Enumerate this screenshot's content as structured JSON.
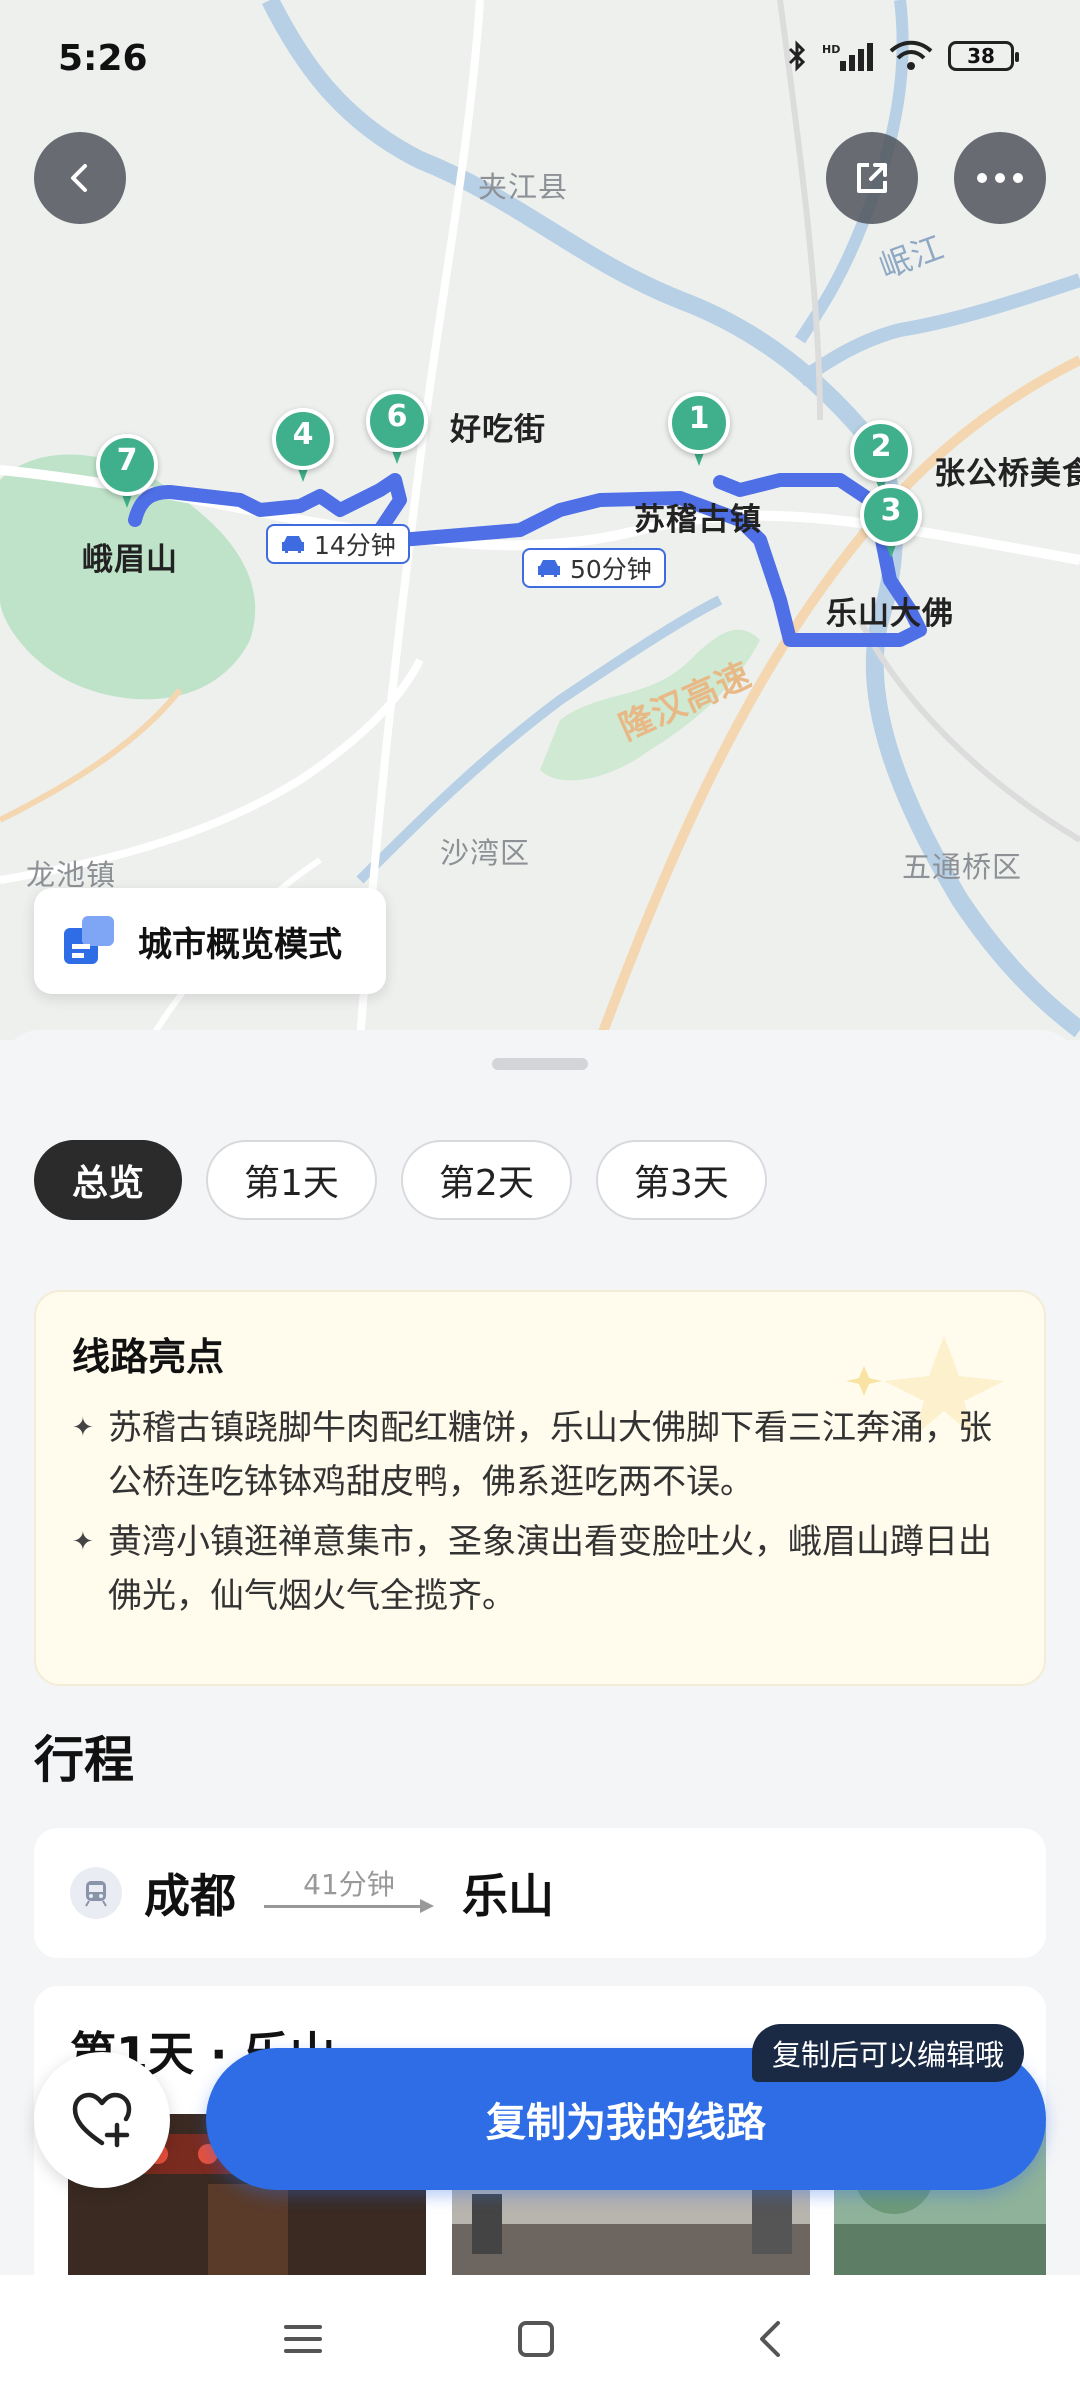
{
  "status_bar": {
    "time": "5:26",
    "battery": "38"
  },
  "map": {
    "labels": {
      "jiajiang": "夹江县",
      "minjiang": "岷江",
      "haochijie": "好吃街",
      "zhanggongqiao": "张公桥美食",
      "sujigu": "苏稽古镇",
      "leshan_dafo": "乐山大佛",
      "emeishan": "峨眉山",
      "longhan": "隆汉高速",
      "shawan": "沙湾区",
      "longchi": "龙池镇",
      "wutongqiao": "五通桥区"
    },
    "pins": [
      "1",
      "2",
      "3",
      "4",
      "6",
      "7"
    ],
    "durations": {
      "d1": "14分钟",
      "d2": "50分钟"
    },
    "overview_mode": "城市概览模式",
    "colors": {
      "route": "#4e6fe6",
      "pin": "#3fb08b"
    }
  },
  "tabs": [
    {
      "label": "总览",
      "active": true
    },
    {
      "label": "第1天",
      "active": false
    },
    {
      "label": "第2天",
      "active": false
    },
    {
      "label": "第3天",
      "active": false
    }
  ],
  "highlights": {
    "title": "线路亮点",
    "items": [
      "苏稽古镇跷脚牛肉配红糖饼，乐山大佛脚下看三江奔涌，张公桥连吃钵钵鸡甜皮鸭，佛系逛吃两不误。",
      "黄湾小镇逛禅意集市，圣象演出看变脸吐火，峨眉山蹲日出佛光，仙气烟火气全揽齐。"
    ]
  },
  "itinerary": {
    "title": "行程",
    "route": {
      "from": "成都",
      "duration": "41分钟",
      "to": "乐山"
    },
    "day1_title": "第1天 · 乐山"
  },
  "actions": {
    "copy_button": "复制为我的线路",
    "copy_tip": "复制后可以编辑哦"
  },
  "colors": {
    "accent": "#2e6de6",
    "dark_tab": "#2b2b2b"
  }
}
